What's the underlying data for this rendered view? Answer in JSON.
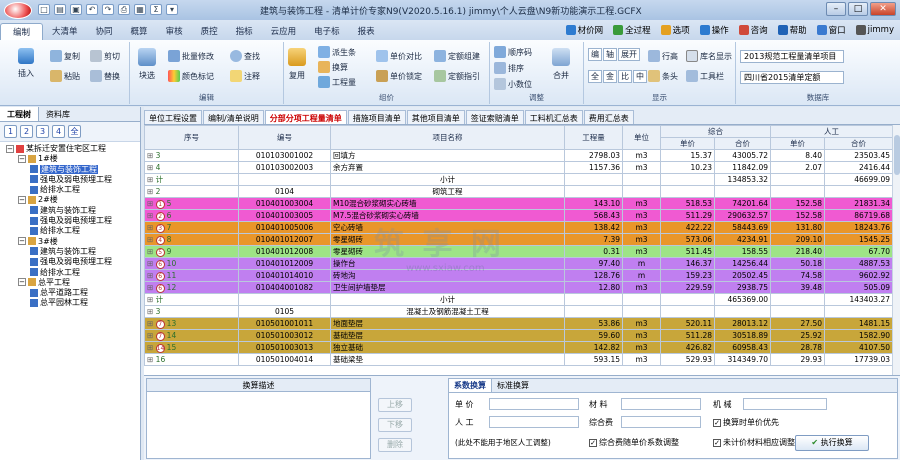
{
  "window": {
    "title": "建筑与装饰工程 - 清单计价专家N9(V2020.5.16.1) jimmy\\个人云盘\\N9新功能演示工程.GCFX"
  },
  "menu_tabs": [
    "编制",
    "大清单",
    "协同",
    "概算",
    "审核",
    "质控",
    "指标",
    "云应用",
    "电子标",
    "报表"
  ],
  "top_tools": [
    {
      "label": "材价网",
      "icon": "globe-icon"
    },
    {
      "label": "全过程",
      "icon": "cycle-icon"
    },
    {
      "label": "选项",
      "icon": "gear-icon"
    },
    {
      "label": "操作",
      "icon": "user-icon"
    },
    {
      "label": "咨询",
      "icon": "chat-icon"
    },
    {
      "label": "帮助",
      "icon": "help-icon"
    },
    {
      "label": "窗口",
      "icon": "window-icon"
    },
    {
      "label": "jimmy",
      "icon": "person-icon"
    }
  ],
  "ribbon": {
    "insert": "插入",
    "copy": "复制",
    "paste": "粘贴",
    "cut": "剪切",
    "replace": "替换",
    "block": "块选",
    "batch_modify": "批量修改",
    "color_mark": "颜色标记",
    "find": "查找",
    "note": "注释",
    "reuse": "复用",
    "group_edit": "编辑",
    "derive_item": "派生条",
    "convert": "换算",
    "quantity": "工程量",
    "unit_price_compare": "单价对比",
    "unit_price_lock": "单价锁定",
    "quota_edit": "定额组建",
    "quota_guide": "定额指引",
    "group_compose": "组价",
    "sort_order": "顺序码",
    "sort": "排序",
    "decimal": "小数位",
    "merge": "合并",
    "group_adjust": "调整",
    "group_display": "显示",
    "row": "行高",
    "price_reg": "库名显示",
    "all": "全",
    "jin": "金",
    "bi": "比",
    "zhong": "中",
    "bian": "编",
    "zhou": "轴",
    "fold": "展开",
    "tiao": "条头",
    "work_tool": "工具栏",
    "db_select1": "2013规范工程量清单项目",
    "db_select2": "四川省2015清单定额",
    "group_database": "数据库"
  },
  "left_panel": {
    "tabs": [
      "工程树",
      "资料库"
    ],
    "levels": [
      "1",
      "2",
      "3",
      "4",
      "全"
    ],
    "tree": [
      {
        "label": "某拆迁安置住宅区工程",
        "depth": 0,
        "toggle": "−",
        "sel": false
      },
      {
        "label": "1#楼",
        "depth": 1,
        "toggle": "−",
        "sel": false
      },
      {
        "label": "建筑与装饰工程",
        "depth": 2,
        "toggle": "",
        "sel": true
      },
      {
        "label": "强电及弱电预埋工程",
        "depth": 2,
        "toggle": "",
        "sel": false
      },
      {
        "label": "给排水工程",
        "depth": 2,
        "toggle": "",
        "sel": false
      },
      {
        "label": "2#楼",
        "depth": 1,
        "toggle": "−",
        "sel": false
      },
      {
        "label": "建筑与装饰工程",
        "depth": 2,
        "toggle": "",
        "sel": false
      },
      {
        "label": "强电及弱电预埋工程",
        "depth": 2,
        "toggle": "",
        "sel": false
      },
      {
        "label": "给排水工程",
        "depth": 2,
        "toggle": "",
        "sel": false
      },
      {
        "label": "3#楼",
        "depth": 1,
        "toggle": "−",
        "sel": false
      },
      {
        "label": "建筑与装饰工程",
        "depth": 2,
        "toggle": "",
        "sel": false
      },
      {
        "label": "强电及弱电预埋工程",
        "depth": 2,
        "toggle": "",
        "sel": false
      },
      {
        "label": "给排水工程",
        "depth": 2,
        "toggle": "",
        "sel": false
      },
      {
        "label": "总平工程",
        "depth": 1,
        "toggle": "−",
        "sel": false
      },
      {
        "label": "总平道路工程",
        "depth": 2,
        "toggle": "",
        "sel": false
      },
      {
        "label": "总平园林工程",
        "depth": 2,
        "toggle": "",
        "sel": false
      }
    ]
  },
  "sub_tabs": [
    "单位工程设置",
    "编制/清单说明",
    "分部分项工程量清单",
    "措施项目清单",
    "其他项目清单",
    "签证索赔清单",
    "工料机汇总表",
    "费用汇总表"
  ],
  "grid": {
    "headers": {
      "seq": "序号",
      "code": "编号",
      "name": "项目名称",
      "qty": "工程量",
      "unit": "单位",
      "zonghe": "综合",
      "rengong": "人工",
      "unit_price": "单价",
      "total": "合价"
    },
    "rows": [
      {
        "seq": "3",
        "mark": "",
        "code": "010103001002",
        "name": "回填方",
        "qty": "2798.03",
        "unit": "m3",
        "p1": "15.37",
        "t1": "43005.72",
        "p2": "8.40",
        "t2": "23503.45",
        "color": "#ffffff"
      },
      {
        "seq": "4",
        "mark": "",
        "code": "010103002003",
        "name": "余方弃置",
        "qty": "1157.36",
        "unit": "m3",
        "p1": "10.23",
        "t1": "11842.09",
        "p2": "2.07",
        "t2": "2416.44",
        "color": "#ffffff"
      },
      {
        "seq": "计",
        "mark": "",
        "code": "",
        "name": "小计",
        "qty": "",
        "unit": "",
        "p1": "",
        "t1": "134853.32",
        "p2": "",
        "t2": "46699.09",
        "color": "#ffffff",
        "center": true
      },
      {
        "seq": "2",
        "mark": "",
        "code": "0104",
        "name": "砌筑工程",
        "qty": "",
        "unit": "",
        "p1": "",
        "t1": "",
        "p2": "",
        "t2": "",
        "color": "#ffffff",
        "center": true
      },
      {
        "seq": "5",
        "mark": "1",
        "code": "010401003004",
        "name": "M10混合砂浆砌实心砖墙",
        "qty": "143.10",
        "unit": "m3",
        "p1": "518.53",
        "t1": "74201.64",
        "p2": "152.58",
        "t2": "21831.34",
        "color": "#f05ad2"
      },
      {
        "seq": "6",
        "mark": "2",
        "code": "010401003005",
        "name": "M7.5混合砂浆砌实心砖墙",
        "qty": "568.43",
        "unit": "m3",
        "p1": "511.29",
        "t1": "290632.57",
        "p2": "152.58",
        "t2": "86719.68",
        "color": "#f05ad2"
      },
      {
        "seq": "7",
        "mark": "3",
        "code": "010401005006",
        "name": "空心砖墙",
        "qty": "138.42",
        "unit": "m3",
        "p1": "422.22",
        "t1": "58443.69",
        "p2": "131.80",
        "t2": "18243.76",
        "color": "#e9962a"
      },
      {
        "seq": "8",
        "mark": "4",
        "code": "010401012007",
        "name": "零星砌砖",
        "qty": "7.39",
        "unit": "m3",
        "p1": "573.06",
        "t1": "4234.91",
        "p2": "209.10",
        "t2": "1545.25",
        "color": "#e9962a"
      },
      {
        "seq": "9",
        "mark": "5",
        "code": "010401012008",
        "name": "零星砌砖",
        "qty": "0.31",
        "unit": "m3",
        "p1": "511.45",
        "t1": "158.55",
        "p2": "218.40",
        "t2": "67.70",
        "color": "#9ee486"
      },
      {
        "seq": "10",
        "mark": "6",
        "code": "010401012009",
        "name": "操作台",
        "qty": "97.40",
        "unit": "m",
        "p1": "146.37",
        "t1": "14256.44",
        "p2": "50.18",
        "t2": "4887.53",
        "color": "#c07ff0"
      },
      {
        "seq": "11",
        "mark": "6",
        "code": "010401014010",
        "name": "砖地沟",
        "qty": "128.76",
        "unit": "m",
        "p1": "159.23",
        "t1": "20502.45",
        "p2": "74.58",
        "t2": "9602.92",
        "color": "#c07ff0"
      },
      {
        "seq": "12",
        "mark": "6",
        "code": "010404001082",
        "name": "卫生间护墙垫层",
        "qty": "12.80",
        "unit": "m3",
        "p1": "229.59",
        "t1": "2938.75",
        "p2": "39.48",
        "t2": "505.09",
        "color": "#c07ff0"
      },
      {
        "seq": "计",
        "mark": "",
        "code": "",
        "name": "小计",
        "qty": "",
        "unit": "",
        "p1": "",
        "t1": "465369.00",
        "p2": "",
        "t2": "143403.27",
        "color": "#ffffff",
        "center": true
      },
      {
        "seq": "3",
        "mark": "",
        "code": "0105",
        "name": "混凝土及钢筋混凝土工程",
        "qty": "",
        "unit": "",
        "p1": "",
        "t1": "",
        "p2": "",
        "t2": "",
        "color": "#ffffff",
        "center": true
      },
      {
        "seq": "13",
        "mark": "7",
        "code": "010501001011",
        "name": "地面垫层",
        "qty": "53.86",
        "unit": "m3",
        "p1": "520.11",
        "t1": "28013.12",
        "p2": "27.50",
        "t2": "1481.15",
        "color": "#c8a63a"
      },
      {
        "seq": "14",
        "mark": "7",
        "code": "010501003012",
        "name": "基础垫层",
        "qty": "59.60",
        "unit": "m3",
        "p1": "511.28",
        "t1": "30518.89",
        "p2": "25.92",
        "t2": "1582.90",
        "color": "#c8a63a"
      },
      {
        "seq": "15",
        "mark": "14",
        "code": "010501003013",
        "name": "独立基础",
        "qty": "142.82",
        "unit": "m3",
        "p1": "426.82",
        "t1": "60958.43",
        "p2": "28.78",
        "t2": "4107.50",
        "color": "#c8a63a"
      },
      {
        "seq": "16",
        "mark": "",
        "code": "010501004014",
        "name": "基础梁垫",
        "qty": "593.15",
        "unit": "m3",
        "p1": "529.93",
        "t1": "314349.70",
        "p2": "29.93",
        "t2": "17739.03",
        "color": "#ffffff"
      }
    ]
  },
  "bottom": {
    "conv_desc": "换算描述",
    "btn_up": "上移",
    "btn_down": "下移",
    "btn_delete": "删除",
    "calc_tabs": [
      "系数换算",
      "标准换算"
    ],
    "unit_price": "单 价",
    "material": "材 料",
    "machine": "机 械",
    "labor": "人 工",
    "comp_fee": "综合费",
    "note": "(此处不能用于地区人工调整)",
    "chk1": "换算时单价优先",
    "chk2": "综合费随单价系数调整",
    "chk3": "未计价材料相应调整",
    "exec": "执行换算"
  },
  "watermark": "筑 享 网",
  "watermark_url": "www.sxiaw.com"
}
